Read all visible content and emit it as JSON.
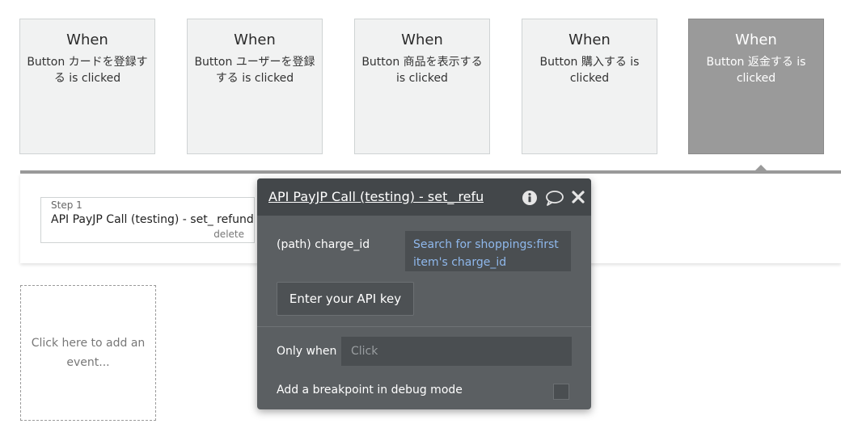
{
  "events": [
    {
      "when": "When",
      "description": "Button カードを登録する is clicked",
      "selected": false
    },
    {
      "when": "When",
      "description": "Button ユーザーを登録する is clicked",
      "selected": false
    },
    {
      "when": "When",
      "description": "Button 商品を表示する is clicked",
      "selected": false
    },
    {
      "when": "When",
      "description": "Button 購入する is clicked",
      "selected": false
    },
    {
      "when": "When",
      "description": "Button 返金する is clicked",
      "selected": true
    }
  ],
  "step": {
    "number_label": "Step 1",
    "title": "API PayJP Call (testing) - set_ refund",
    "delete_label": "delete"
  },
  "add_event": {
    "label": "Click here to add an event..."
  },
  "popup": {
    "title": "API PayJP Call (testing) - set_ refund",
    "icons": {
      "info": "info-icon",
      "comment": "comment-icon",
      "close": "close-icon"
    },
    "charge_id_label": "(path) charge_id",
    "charge_id_value": "Search for shoppings:first item's charge_id",
    "api_key_button": "Enter your API key",
    "only_when_label": "Only when",
    "only_when_placeholder": "Click",
    "breakpoint_label": "Add a breakpoint in debug mode"
  },
  "colors": {
    "selected_event": "#9a9a9a",
    "popup_bg": "#5b5f62",
    "popup_header": "#43474a",
    "dynamic_value": "#8fb8ec"
  }
}
